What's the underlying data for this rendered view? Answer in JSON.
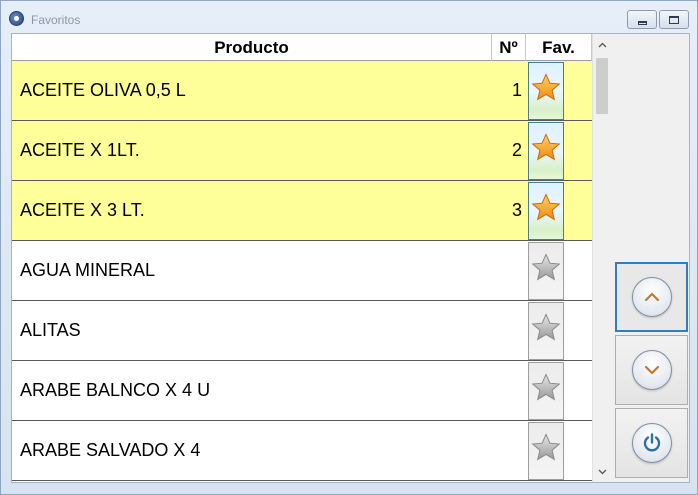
{
  "window": {
    "title": "Favoritos"
  },
  "table": {
    "headers": {
      "product": "Producto",
      "number": "Nº",
      "favorite": "Fav."
    },
    "rows": [
      {
        "product": "ACEITE OLIVA 0,5 L",
        "number": "1",
        "favorite": true
      },
      {
        "product": "ACEITE X 1LT.",
        "number": "2",
        "favorite": true
      },
      {
        "product": "ACEITE X 3 LT.",
        "number": "3",
        "favorite": true
      },
      {
        "product": "AGUA MINERAL",
        "number": "",
        "favorite": false
      },
      {
        "product": "ALITAS",
        "number": "",
        "favorite": false
      },
      {
        "product": "ARABE BALNCO X 4 U",
        "number": "",
        "favorite": false
      },
      {
        "product": "ARABE SALVADO X 4",
        "number": "",
        "favorite": false
      }
    ]
  },
  "side_buttons": [
    "chevron-up-icon",
    "chevron-down-icon",
    "power-icon"
  ],
  "colors": {
    "favorite_row": "#ffff99",
    "accent": "#2f7ec2",
    "star_on": "#f7a21b",
    "star_off": "#b5b5b5"
  }
}
